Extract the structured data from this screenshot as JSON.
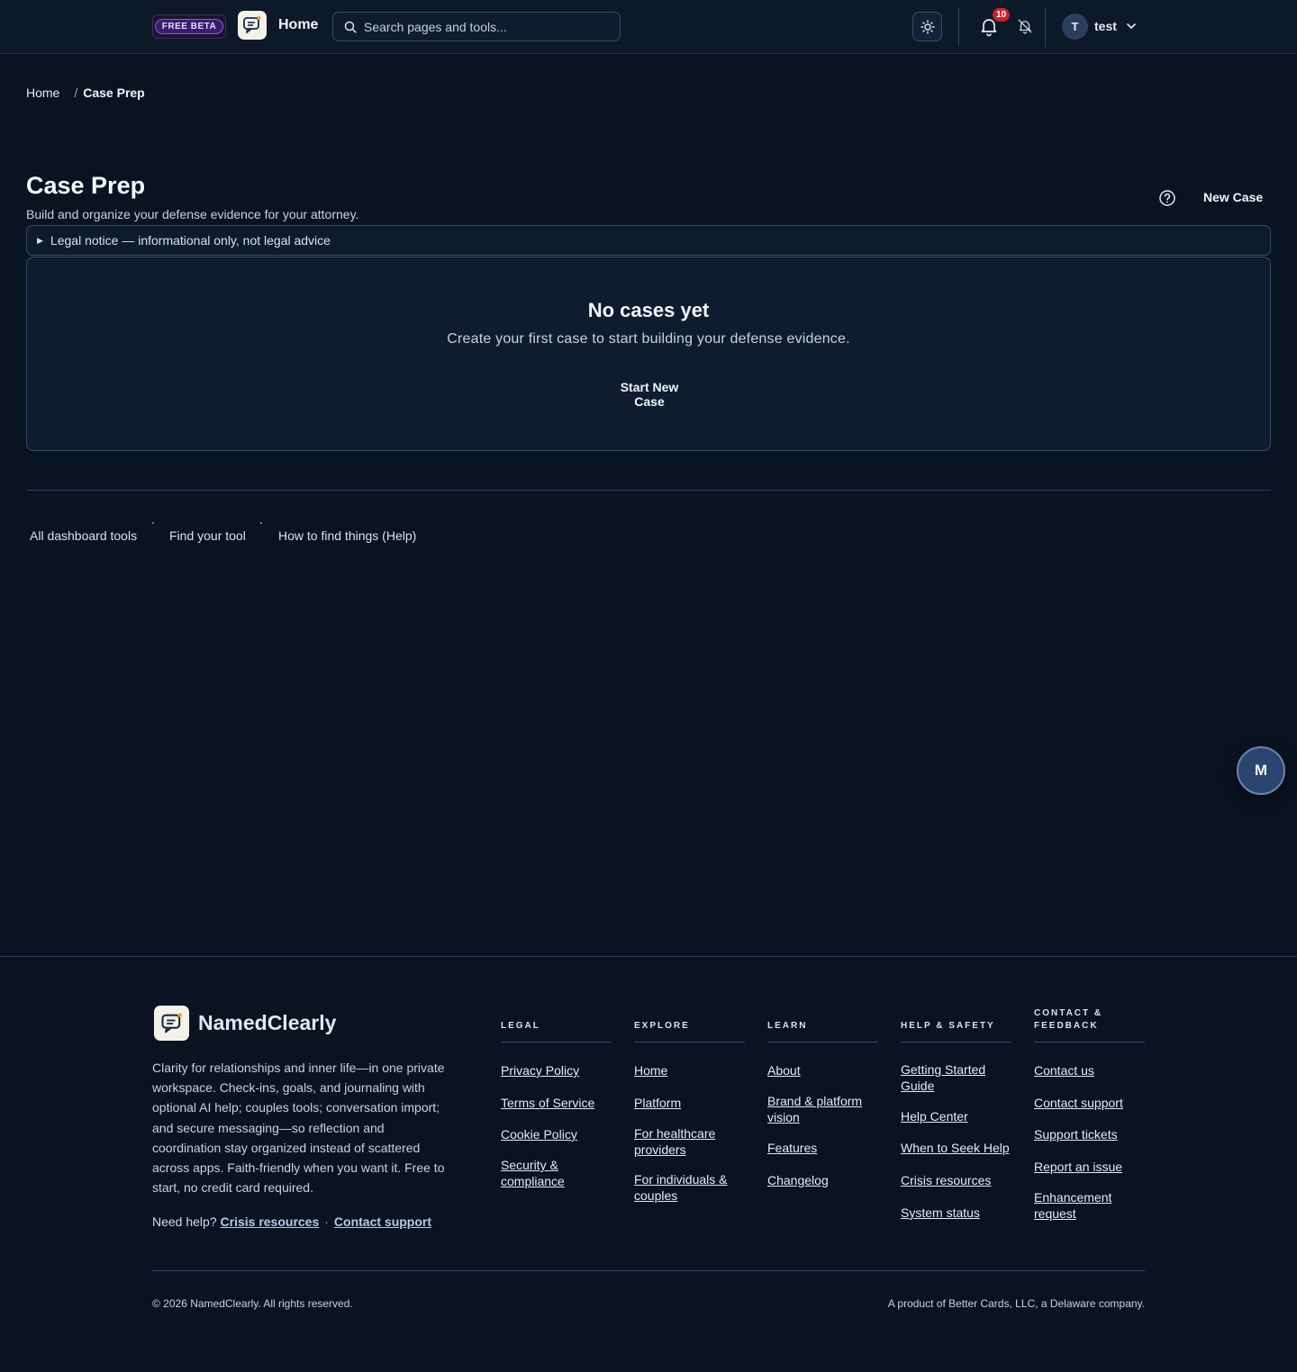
{
  "header": {
    "beta_label": "FREE BETA",
    "home_label": "Home",
    "search_placeholder": "Search pages and tools...",
    "notification_count": "10",
    "user_initial": "T",
    "user_name": "test"
  },
  "breadcrumb": {
    "home": "Home",
    "separator": "/",
    "current": "Case Prep"
  },
  "page": {
    "title": "Case Prep",
    "subtitle": "Build and organize your defense evidence for your attorney.",
    "new_case_label": "New Case",
    "legal_notice": "Legal notice — informational only, not legal advice"
  },
  "empty_state": {
    "title": "No cases yet",
    "description": "Create your first case to start building your defense evidence.",
    "button": "Start New Case"
  },
  "tool_links": [
    "All dashboard tools",
    "Find your tool",
    "How to find things (Help)"
  ],
  "fab_label": "M",
  "footer": {
    "brand": "NamedClearly",
    "description": "Clarity for relationships and inner life—in one private workspace. Check-ins, goals, and journaling with optional AI help; couples tools; conversation import; and secure messaging—so reflection and coordination stay organized instead of scattered across apps. Faith-friendly when you want it. Free to start, no credit card required.",
    "need_help": "Need help?",
    "crisis_link": "Crisis resources",
    "separator": "·",
    "contact_link": "Contact support",
    "columns": [
      {
        "heading": "LEGAL",
        "links": [
          "Privacy Policy",
          "Terms of Service",
          "Cookie Policy",
          "Security & compliance"
        ]
      },
      {
        "heading": "EXPLORE",
        "links": [
          "Home",
          "Platform",
          "For healthcare providers",
          "For individuals & couples"
        ]
      },
      {
        "heading": "LEARN",
        "links": [
          "About",
          "Brand & platform vision",
          "Features",
          "Changelog"
        ]
      },
      {
        "heading": "HELP & SAFETY",
        "links": [
          "Getting Started Guide",
          "Help Center",
          "When to Seek Help",
          "Crisis resources",
          "System status"
        ]
      },
      {
        "heading": "CONTACT & FEEDBACK",
        "links": [
          "Contact us",
          "Contact support",
          "Support tickets",
          "Report an issue",
          "Enhancement request"
        ]
      }
    ],
    "copyright": "© 2026 NamedClearly. All rights reserved.",
    "product_of": "A product of Better Cards, LLC, a Delaware company."
  }
}
